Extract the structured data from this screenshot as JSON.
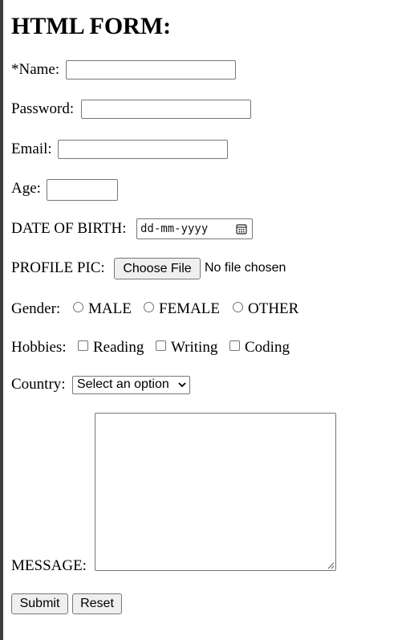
{
  "form": {
    "title": "HTML FORM:",
    "name_label": "*Name:",
    "password_label": "Password:",
    "email_label": "Email:",
    "age_label": "Age:",
    "dob_label": "DATE OF BIRTH:",
    "dob_placeholder": "dd-mm-yyyy",
    "profile_label": "PROFILE PIC:",
    "choose_file_label": "Choose File",
    "no_file_text": "No file chosen",
    "gender_label": "Gender:",
    "gender_options": [
      "MALE",
      "FEMALE",
      "OTHER"
    ],
    "hobbies_label": "Hobbies:",
    "hobby_options": [
      "Reading",
      "Writing",
      "Coding"
    ],
    "country_label": "Country:",
    "country_selected": "Select an option",
    "message_label": "MESSAGE:",
    "submit_label": "Submit",
    "reset_label": "Reset"
  },
  "icons": {
    "date": "calendar-icon",
    "select": "chevron-down-icon",
    "textarea": "resize-grip-icon"
  }
}
